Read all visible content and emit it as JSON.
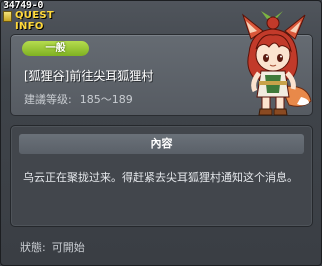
{
  "window": {
    "quest_id": "34749-0",
    "title": "QUEST INFO"
  },
  "header": {
    "badge": "一般",
    "quest_title": "[狐狸谷]前往尖耳狐狸村",
    "level_label": "建議等级:",
    "level_value": "185〜189",
    "npc_icon": "fox-girl-npc-portrait"
  },
  "content": {
    "header": "內容",
    "text": "乌云正在聚拢过来。得赶紧去尖耳狐狸村通知这个消息。"
  },
  "footer": {
    "status_label": "狀態:",
    "status_value": "可開始"
  },
  "colors": {
    "title": "#ffd93b",
    "badge": "#8fc02c",
    "background": "#3b3f45"
  }
}
